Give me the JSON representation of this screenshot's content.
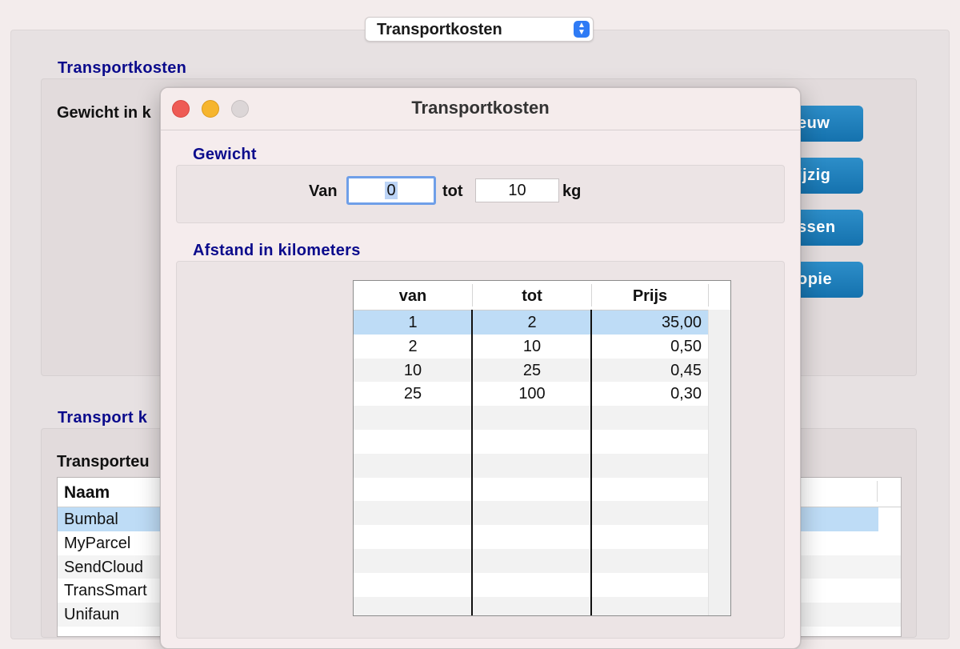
{
  "top_selector": {
    "value": "Transportkosten",
    "arrow_icon": "updown-chevron-icon",
    "accent": "#2f7bf5"
  },
  "background": {
    "section1_title": "Transportkosten",
    "weight_label": "Gewicht in k",
    "buttons": [
      "euw",
      "ijzig",
      "ssen",
      "opie"
    ],
    "section2_title": "Transport k",
    "carriers_label": "Transporteu",
    "carrier_table": {
      "header": "Naam",
      "rows": [
        "Bumbal",
        "MyParcel",
        "SendCloud",
        "TransSmart",
        "Unifaun"
      ],
      "selected_index": 0
    }
  },
  "dialog": {
    "title": "Transportkosten",
    "weight_section": {
      "title": "Gewicht",
      "from_label": "Van",
      "from_value": "0",
      "to_label": "tot",
      "to_value": "10",
      "unit": "kg"
    },
    "distance_section": {
      "title": "Afstand in kilometers",
      "columns": [
        "van",
        "tot",
        "Prijs"
      ],
      "rows": [
        [
          "1",
          "2",
          "35,00"
        ],
        [
          "2",
          "10",
          "0,50"
        ],
        [
          "10",
          "25",
          "0,45"
        ],
        [
          "25",
          "100",
          "0,30"
        ]
      ],
      "selected_index": 0
    }
  },
  "colors": {
    "section_title": "#0b0b8c",
    "button_blue": "#1a7fbf",
    "selection": "#bedcf6"
  }
}
